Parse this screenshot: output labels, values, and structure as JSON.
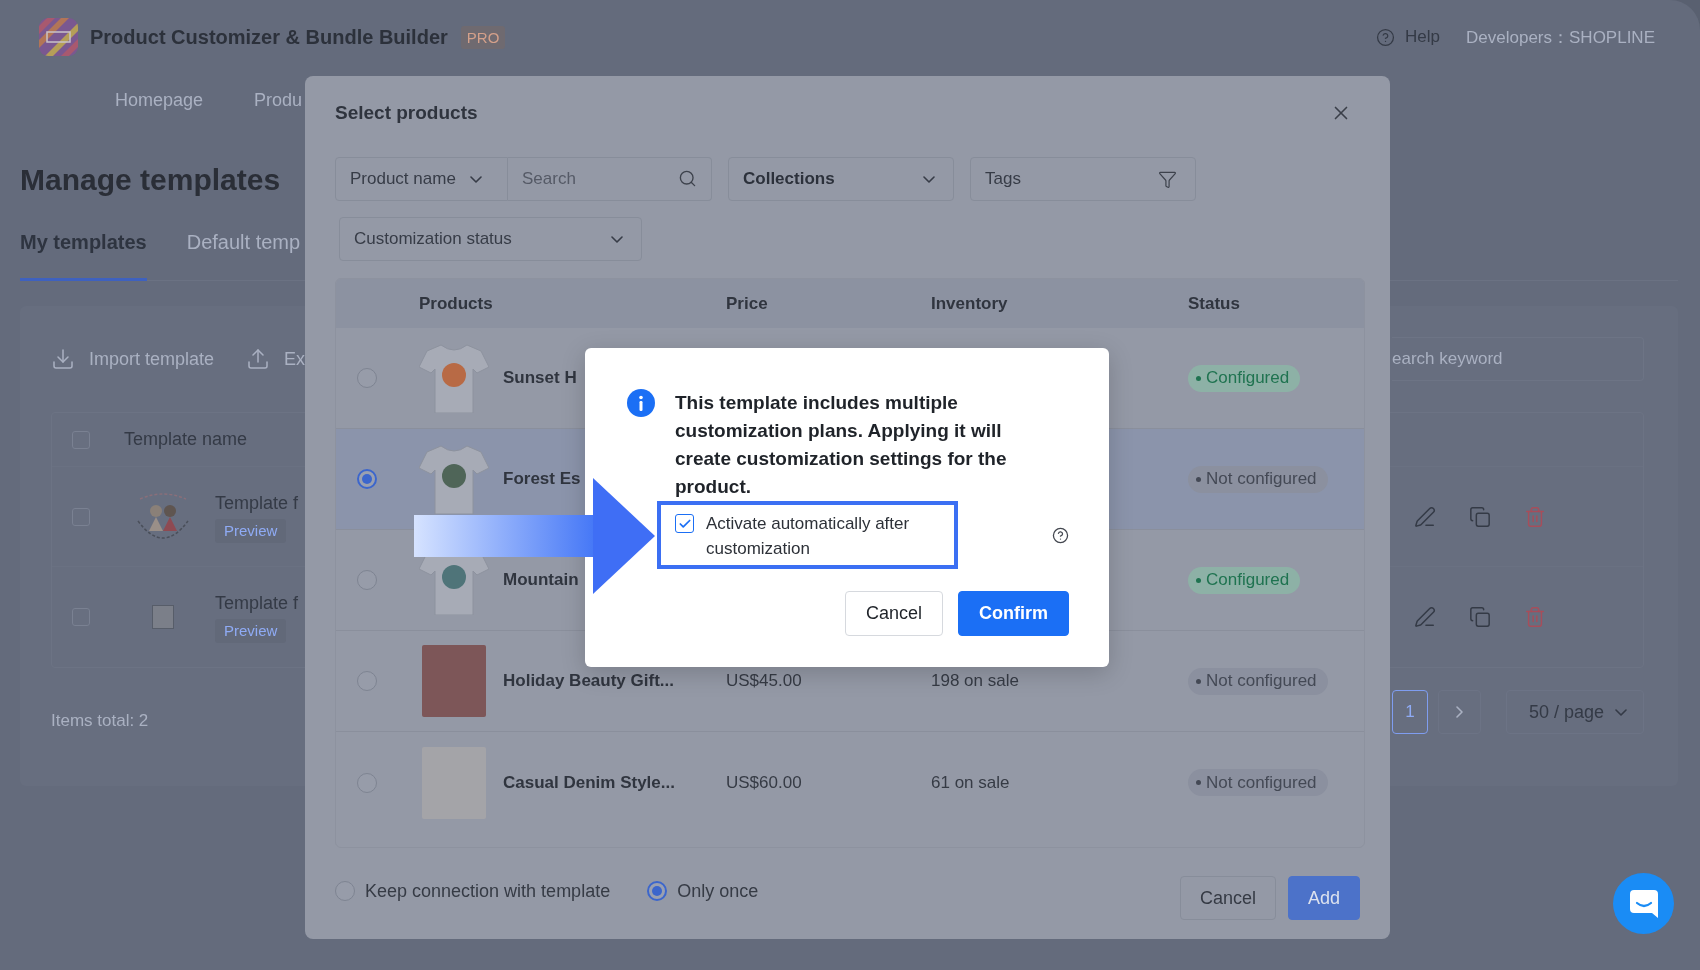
{
  "header": {
    "app_name": "Product Customizer & Bundle Builder",
    "badge": "PRO",
    "help": "Help",
    "developer": "Developers：SHOPLINE"
  },
  "nav": [
    "Homepage",
    "Produ"
  ],
  "page": {
    "title": "Manage templates",
    "tabs": [
      {
        "label": "My templates",
        "selected": true
      },
      {
        "label": "Default temp",
        "selected": false
      }
    ],
    "toolbar": [
      {
        "kind": "import",
        "label": "Import template"
      },
      {
        "kind": "export",
        "label": "Ex"
      }
    ],
    "search": {
      "placeholder": "earch keyword"
    },
    "table": {
      "header_checked": false,
      "columns": [
        "Template name"
      ],
      "rows": [
        {
          "kind": "sticker",
          "name": "Template f",
          "link": "Preview",
          "checked": false
        },
        {
          "kind": "photo",
          "name": "Template f",
          "link": "Preview",
          "checked": false
        }
      ]
    },
    "items_total": "Items total: 2",
    "pagination": {
      "pages": [
        {
          "label": "1",
          "selected": true
        }
      ],
      "page_size": "50 / page"
    }
  },
  "modal": {
    "title": "Select products",
    "search": {
      "field": "Product name",
      "placeholder": "Search"
    },
    "filters": [
      {
        "kind": "select",
        "label": "Collections",
        "bold": true
      },
      {
        "kind": "filter",
        "label": "Tags",
        "bold": false
      },
      {
        "kind": "select",
        "label": "Customization status",
        "bold": false
      }
    ],
    "columns": [
      "Products",
      "Price",
      "Inventory",
      "Status"
    ],
    "products": [
      {
        "kind": "tshirt",
        "name": "Sunset H",
        "status": "Configured",
        "configured": true,
        "selected": false
      },
      {
        "kind": "tshirt",
        "name": "Forest Es",
        "status": "Not configured",
        "configured": false,
        "selected": true
      },
      {
        "kind": "tshirt",
        "name": "Mountain",
        "status": "Configured",
        "configured": true,
        "selected": false
      },
      {
        "kind": "photo",
        "name": "Holiday Beauty Gift...",
        "price": "US$45.00",
        "inventory": "198 on sale",
        "status": "Not configured",
        "configured": false,
        "selected": false
      },
      {
        "kind": "photo",
        "name": "Casual Denim Style...",
        "price": "US$60.00",
        "inventory": "61 on sale",
        "status": "Not configured",
        "configured": false,
        "selected": false
      }
    ],
    "link_modes": [
      {
        "label": "Keep connection with template",
        "selected": false
      },
      {
        "label": "Only once",
        "selected": true
      }
    ],
    "buttons": [
      {
        "kind": "secondary",
        "label": "Cancel"
      },
      {
        "kind": "primary",
        "label": "Add"
      }
    ]
  },
  "dialog": {
    "message": "This template includes multiple customization plans. Applying it will create customization settings for the product.",
    "checkbox": {
      "label": "Activate automatically after customization",
      "checked": true
    },
    "buttons": [
      {
        "kind": "secondary",
        "label": "Cancel"
      },
      {
        "kind": "primary",
        "label": "Confirm"
      }
    ]
  }
}
